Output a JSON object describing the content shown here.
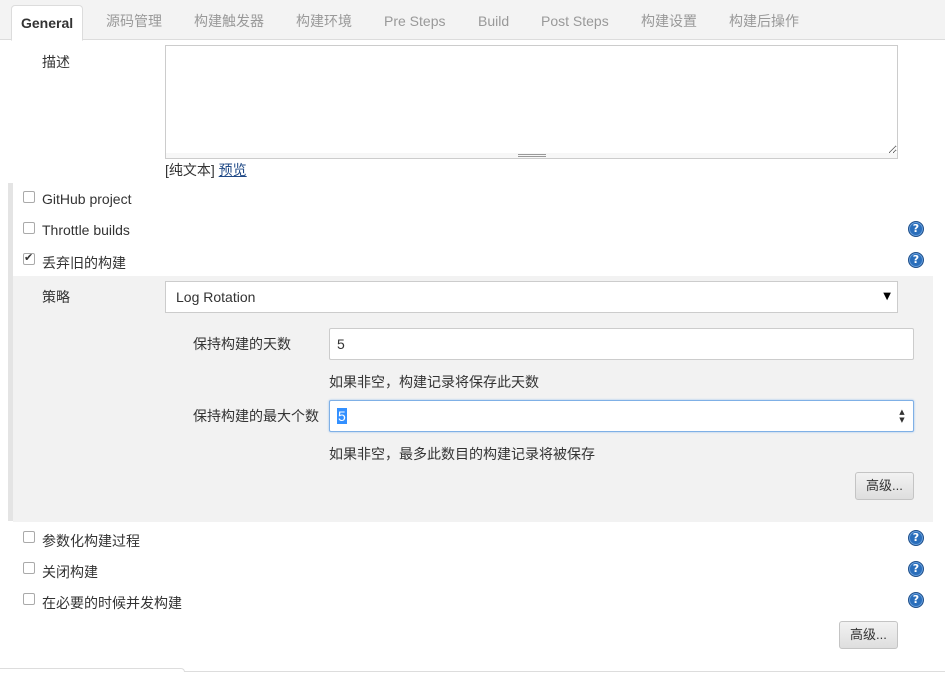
{
  "tabs": [
    {
      "label": "General",
      "active": true
    },
    {
      "label": "源码管理"
    },
    {
      "label": "构建触发器"
    },
    {
      "label": "构建环境"
    },
    {
      "label": "Pre Steps"
    },
    {
      "label": "Build"
    },
    {
      "label": "Post Steps"
    },
    {
      "label": "构建设置"
    },
    {
      "label": "构建后操作"
    }
  ],
  "description": {
    "label": "描述",
    "value": "",
    "plain_text": "[纯文本]",
    "preview_link": "预览"
  },
  "options": {
    "github_project": {
      "label": "GitHub project",
      "checked": false
    },
    "throttle_builds": {
      "label": "Throttle builds",
      "checked": false
    },
    "discard_old_builds": {
      "label": "丢弃旧的构建",
      "checked": true
    },
    "parameterized": {
      "label": "参数化构建过程",
      "checked": false
    },
    "disable_build": {
      "label": "关闭构建",
      "checked": false
    },
    "concurrent_builds": {
      "label": "在必要的时候并发构建",
      "checked": false
    }
  },
  "strategy": {
    "label": "策略",
    "selected": "Log Rotation",
    "days_to_keep": {
      "label": "保持构建的天数",
      "value": "5",
      "hint": "如果非空，构建记录将保存此天数"
    },
    "max_builds": {
      "label": "保持构建的最大个数",
      "value": "5",
      "hint": "如果非空，最多此数目的构建记录将被保存"
    },
    "advanced_label": "高级..."
  },
  "advanced_label": "高级...",
  "help_icon_glyph": "?",
  "colors": {
    "help_icon": "#2a6ebb",
    "link": "#204a87",
    "selection": "#3390ff"
  }
}
